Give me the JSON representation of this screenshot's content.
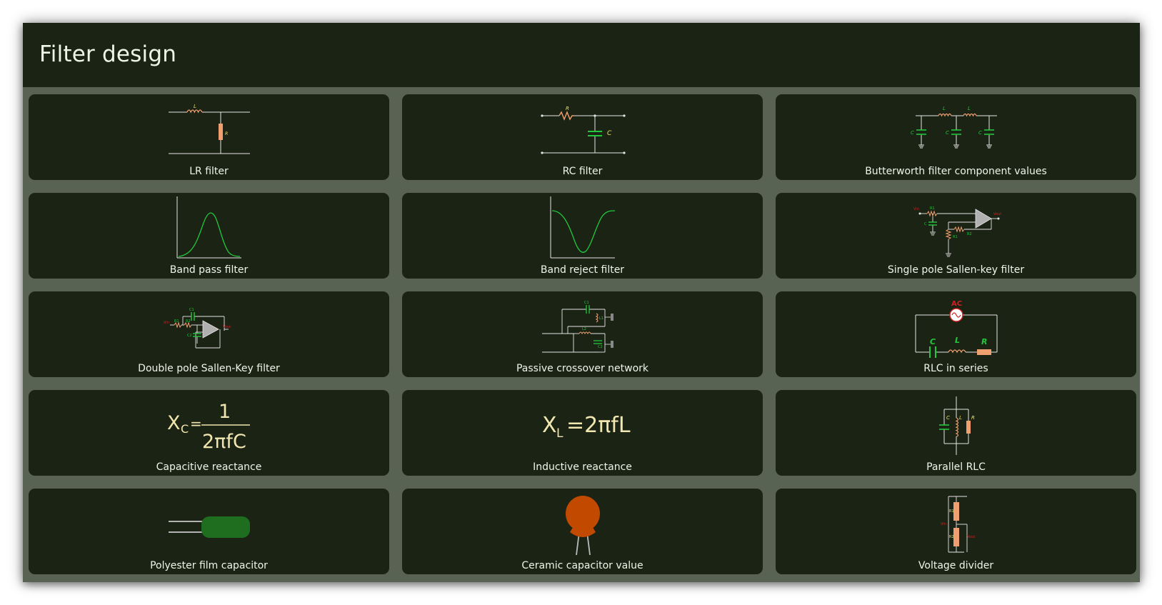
{
  "app": {
    "title": "Filter design"
  },
  "colors": {
    "header_bg": "#1b2314",
    "card_bg": "#1b2314",
    "grid_bg": "#586353",
    "text": "#f1f4ea",
    "wire": "#e6e6e6",
    "component_green": "#22c83c",
    "component_orange": "#f0a070",
    "label_yellow": "#f0e060",
    "label_red": "#d02020"
  },
  "items": [
    {
      "label": "LR filter",
      "icon": "lr-filter-icon"
    },
    {
      "label": "RC filter",
      "icon": "rc-filter-icon"
    },
    {
      "label": "Butterworth filter component values",
      "icon": "butterworth-filter-icon"
    },
    {
      "label": "Band pass filter",
      "icon": "band-pass-curve-icon"
    },
    {
      "label": "Band reject filter",
      "icon": "band-reject-curve-icon"
    },
    {
      "label": "Single pole Sallen-key filter",
      "icon": "single-pole-sallen-key-icon"
    },
    {
      "label": "Double pole Sallen-Key filter",
      "icon": "double-pole-sallen-key-icon"
    },
    {
      "label": "Passive crossover network",
      "icon": "crossover-network-icon"
    },
    {
      "label": "RLC in series",
      "icon": "rlc-series-icon"
    },
    {
      "label": "Capacitive reactance",
      "icon": "capacitive-reactance-formula-icon"
    },
    {
      "label": "Inductive reactance",
      "icon": "inductive-reactance-formula-icon"
    },
    {
      "label": "Parallel RLC",
      "icon": "parallel-rlc-icon"
    },
    {
      "label": "Polyester film capacitor",
      "icon": "film-capacitor-icon"
    },
    {
      "label": "Ceramic capacitor value",
      "icon": "ceramic-capacitor-icon"
    },
    {
      "label": "Voltage divider",
      "icon": "voltage-divider-icon"
    }
  ],
  "icon_text": {
    "L": "L",
    "R": "R",
    "C": "C",
    "C1": "C1",
    "C2": "C2",
    "R1": "R1",
    "R2": "R2",
    "L1": "L1",
    "L2": "L2",
    "AC": "AC",
    "Vin": "Vin",
    "Vout": "Vout",
    "xc_lhs": "X",
    "xc_sub": "C",
    "xc_num": "1",
    "xc_den": "2πfC",
    "xl_lhs": "X",
    "xl_sub": "L",
    "xl_rhs": "=2πfL"
  }
}
